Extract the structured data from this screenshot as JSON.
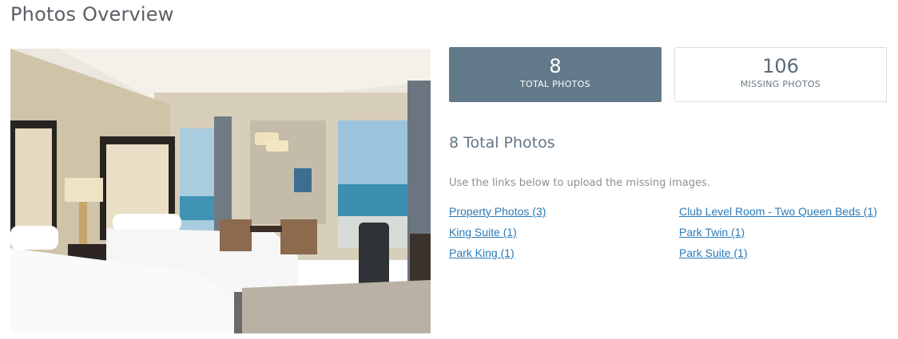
{
  "page": {
    "title": "Photos Overview"
  },
  "photo": {
    "alt": "Hotel room with two beds and sea view"
  },
  "stats": {
    "total": {
      "value": "8",
      "label": "TOTAL PHOTOS"
    },
    "missing": {
      "value": "106",
      "label": "MISSING PHOTOS"
    }
  },
  "section": {
    "title": "8 Total Photos",
    "instructions": "Use the links below to upload the missing images."
  },
  "links": [
    "Property Photos (3)",
    "Club Level Room - Two Queen Beds (1)",
    "King Suite (1)",
    "Park Twin (1)",
    "Park King (1)",
    "Park Suite (1)"
  ],
  "colors": {
    "accent": "#62798a",
    "link": "#2a7ab8"
  }
}
